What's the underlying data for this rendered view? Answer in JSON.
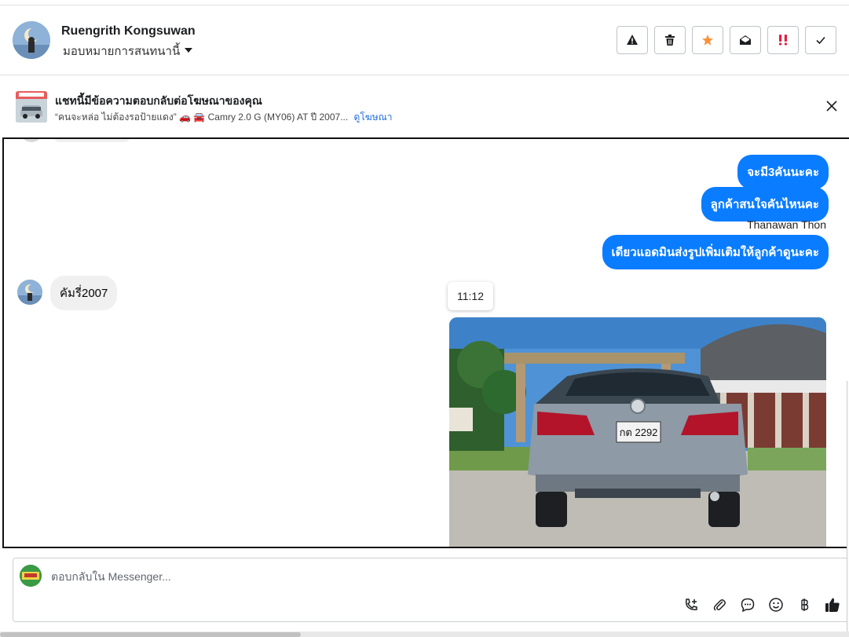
{
  "header": {
    "contact_name": "Ruengrith Kongsuwan",
    "assign_label": "มอบหมายการสนทนานี้",
    "actions": [
      {
        "name": "report-spam-button",
        "icon": "warning-icon"
      },
      {
        "name": "delete-button",
        "icon": "trash-icon"
      },
      {
        "name": "star-button",
        "icon": "star-icon"
      },
      {
        "name": "mark-unread-button",
        "icon": "envelope-open-icon"
      },
      {
        "name": "important-button",
        "icon": "exclamation-icon"
      },
      {
        "name": "mark-done-button",
        "icon": "check-icon"
      }
    ]
  },
  "banner": {
    "title": "แชทนี้มีข้อความตอบกลับต่อโฆษณาของคุณ",
    "subtitle": "“คนจะหล่อ ไม่ต้องรอป้ายแดง” 🚗 🚘 Camry 2.0 G (MY06) AT ปี 2007...",
    "link": "ดูโฆษณา"
  },
  "chat": {
    "outgoing": [
      "จะมี3คันนะคะ",
      "ลูกค้าสนใจคันไหนคะ",
      "เดียวแอดมินส่งรูปเพิ่มเติมให้ลูกค้าดูนะคะ"
    ],
    "sender_name": "Thanawan Thon",
    "incoming": "คัมรี่2007",
    "timestamp": "11:12",
    "photo_plate": "กต 2292"
  },
  "composer": {
    "placeholder": "ตอบกลับใน Messenger..."
  },
  "colors": {
    "outgoing_bubble": "#0a7cff",
    "incoming_bubble": "#f0f0f0",
    "star": "#f7923b",
    "important": "#e41e3f",
    "link": "#216fdb"
  }
}
